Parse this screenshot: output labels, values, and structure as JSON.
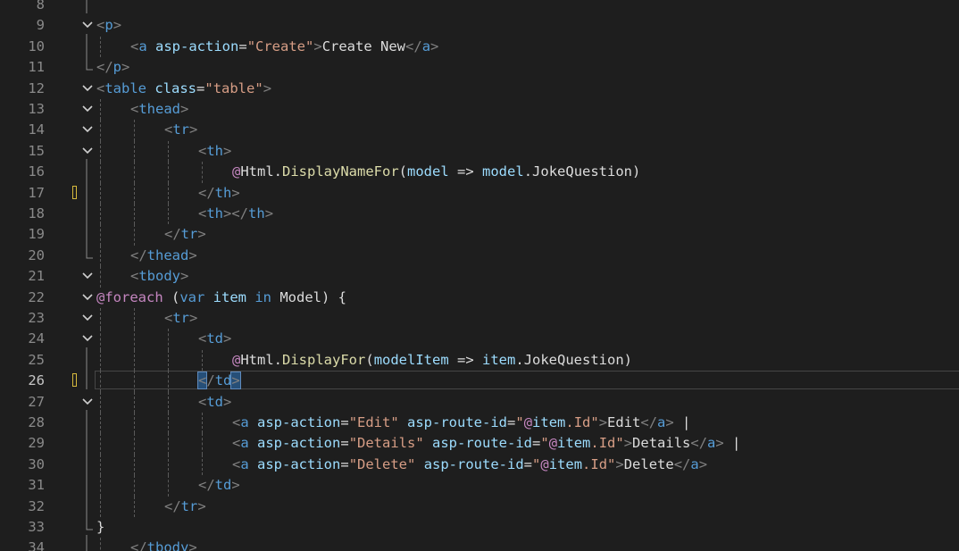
{
  "editor": {
    "active_line": 26,
    "lines": [
      {
        "num": "8",
        "fold": "",
        "indent": 0,
        "tokens": []
      },
      {
        "num": "9",
        "fold": "open",
        "indent": 0,
        "tokens": [
          [
            "t-delim",
            "<"
          ],
          [
            "t-tag",
            "p"
          ],
          [
            "t-delim",
            ">"
          ]
        ]
      },
      {
        "num": "10",
        "fold": "",
        "indent": 1,
        "tokens": [
          [
            "t-delim",
            "<"
          ],
          [
            "t-tag",
            "a "
          ],
          [
            "t-attr",
            "asp-action"
          ],
          [
            "t-text",
            "="
          ],
          [
            "t-str",
            "\"Create\""
          ],
          [
            "t-delim",
            ">"
          ],
          [
            "t-text",
            "Create New"
          ],
          [
            "t-delim",
            "</"
          ],
          [
            "t-tag",
            "a"
          ],
          [
            "t-delim",
            ">"
          ]
        ]
      },
      {
        "num": "11",
        "fold": "end",
        "indent": 0,
        "tokens": [
          [
            "t-delim",
            "</"
          ],
          [
            "t-tag",
            "p"
          ],
          [
            "t-delim",
            ">"
          ]
        ]
      },
      {
        "num": "12",
        "fold": "open",
        "indent": 0,
        "tokens": [
          [
            "t-delim",
            "<"
          ],
          [
            "t-tag",
            "table "
          ],
          [
            "t-attr",
            "class"
          ],
          [
            "t-text",
            "="
          ],
          [
            "t-str",
            "\"table\""
          ],
          [
            "t-delim",
            ">"
          ]
        ]
      },
      {
        "num": "13",
        "fold": "open",
        "indent": 1,
        "tokens": [
          [
            "t-delim",
            "<"
          ],
          [
            "t-tag",
            "thead"
          ],
          [
            "t-delim",
            ">"
          ]
        ]
      },
      {
        "num": "14",
        "fold": "open",
        "indent": 2,
        "tokens": [
          [
            "t-delim",
            "<"
          ],
          [
            "t-tag",
            "tr"
          ],
          [
            "t-delim",
            ">"
          ]
        ]
      },
      {
        "num": "15",
        "fold": "open",
        "indent": 3,
        "tokens": [
          [
            "t-delim",
            "<"
          ],
          [
            "t-tag",
            "th"
          ],
          [
            "t-delim",
            ">"
          ]
        ]
      },
      {
        "num": "16",
        "fold": "",
        "indent": 4,
        "tokens": [
          [
            "t-razor",
            "@"
          ],
          [
            "t-text",
            "Html"
          ],
          [
            "t-text",
            "."
          ],
          [
            "t-method",
            "DisplayNameFor"
          ],
          [
            "t-text",
            "("
          ],
          [
            "t-param",
            "model"
          ],
          [
            "t-text",
            " => "
          ],
          [
            "t-param",
            "model"
          ],
          [
            "t-text",
            "."
          ],
          [
            "t-text",
            "JokeQuestion)"
          ]
        ]
      },
      {
        "num": "17",
        "fold": "",
        "indent": 3,
        "marker": true,
        "tokens": [
          [
            "t-delim",
            "</"
          ],
          [
            "t-tag",
            "th"
          ],
          [
            "t-delim",
            ">"
          ]
        ]
      },
      {
        "num": "18",
        "fold": "",
        "indent": 3,
        "tokens": [
          [
            "t-delim",
            "<"
          ],
          [
            "t-tag",
            "th"
          ],
          [
            "t-delim",
            "></"
          ],
          [
            "t-tag",
            "th"
          ],
          [
            "t-delim",
            ">"
          ]
        ]
      },
      {
        "num": "19",
        "fold": "",
        "indent": 2,
        "tokens": [
          [
            "t-delim",
            "</"
          ],
          [
            "t-tag",
            "tr"
          ],
          [
            "t-delim",
            ">"
          ]
        ]
      },
      {
        "num": "20",
        "fold": "end",
        "indent": 1,
        "tokens": [
          [
            "t-delim",
            "</"
          ],
          [
            "t-tag",
            "thead"
          ],
          [
            "t-delim",
            ">"
          ]
        ]
      },
      {
        "num": "21",
        "fold": "open",
        "indent": 1,
        "tokens": [
          [
            "t-delim",
            "<"
          ],
          [
            "t-tag",
            "tbody"
          ],
          [
            "t-delim",
            ">"
          ]
        ]
      },
      {
        "num": "22",
        "fold": "open",
        "indent": 0,
        "tokens": [
          [
            "t-razor",
            "@foreach"
          ],
          [
            "t-text",
            " ("
          ],
          [
            "t-kw",
            "var"
          ],
          [
            "t-text",
            " "
          ],
          [
            "t-param",
            "item"
          ],
          [
            "t-text",
            " "
          ],
          [
            "t-kw",
            "in"
          ],
          [
            "t-text",
            " Model) {"
          ]
        ]
      },
      {
        "num": "23",
        "fold": "open",
        "indent": 2,
        "tokens": [
          [
            "t-delim",
            "<"
          ],
          [
            "t-tag",
            "tr"
          ],
          [
            "t-delim",
            ">"
          ]
        ]
      },
      {
        "num": "24",
        "fold": "open",
        "indent": 3,
        "tokens": [
          [
            "t-delim",
            "<"
          ],
          [
            "t-tag",
            "td"
          ],
          [
            "t-delim",
            ">"
          ]
        ]
      },
      {
        "num": "25",
        "fold": "",
        "indent": 4,
        "tokens": [
          [
            "t-razor",
            "@"
          ],
          [
            "t-text",
            "Html"
          ],
          [
            "t-text",
            "."
          ],
          [
            "t-method",
            "DisplayFor"
          ],
          [
            "t-text",
            "("
          ],
          [
            "t-param",
            "modelItem"
          ],
          [
            "t-text",
            " => "
          ],
          [
            "t-param",
            "item"
          ],
          [
            "t-text",
            "."
          ],
          [
            "t-text",
            "JokeQuestion)"
          ]
        ]
      },
      {
        "num": "26",
        "fold": "",
        "indent": 3,
        "marker": true,
        "current": true,
        "tokens": [
          [
            "t-delim hl",
            "<"
          ],
          [
            "t-delim",
            "/"
          ],
          [
            "t-tag",
            "td"
          ],
          [
            "t-delim hl",
            ">"
          ]
        ]
      },
      {
        "num": "27",
        "fold": "open",
        "indent": 3,
        "tokens": [
          [
            "t-delim",
            "<"
          ],
          [
            "t-tag",
            "td"
          ],
          [
            "t-delim",
            ">"
          ]
        ]
      },
      {
        "num": "28",
        "fold": "",
        "indent": 4,
        "tokens": [
          [
            "t-delim",
            "<"
          ],
          [
            "t-tag",
            "a "
          ],
          [
            "t-attr",
            "asp-action"
          ],
          [
            "t-text",
            "="
          ],
          [
            "t-str",
            "\"Edit\" "
          ],
          [
            "t-attr",
            "asp-route-id"
          ],
          [
            "t-text",
            "="
          ],
          [
            "t-str",
            "\""
          ],
          [
            "t-razor",
            "@"
          ],
          [
            "t-param",
            "item"
          ],
          [
            "t-str",
            ".Id\""
          ],
          [
            "t-delim",
            ">"
          ],
          [
            "t-text",
            "Edit"
          ],
          [
            "t-delim",
            "</"
          ],
          [
            "t-tag",
            "a"
          ],
          [
            "t-delim",
            ">"
          ],
          [
            "t-text",
            " |"
          ]
        ]
      },
      {
        "num": "29",
        "fold": "",
        "indent": 4,
        "tokens": [
          [
            "t-delim",
            "<"
          ],
          [
            "t-tag",
            "a "
          ],
          [
            "t-attr",
            "asp-action"
          ],
          [
            "t-text",
            "="
          ],
          [
            "t-str",
            "\"Details\" "
          ],
          [
            "t-attr",
            "asp-route-id"
          ],
          [
            "t-text",
            "="
          ],
          [
            "t-str",
            "\""
          ],
          [
            "t-razor",
            "@"
          ],
          [
            "t-param",
            "item"
          ],
          [
            "t-str",
            ".Id\""
          ],
          [
            "t-delim",
            ">"
          ],
          [
            "t-text",
            "Details"
          ],
          [
            "t-delim",
            "</"
          ],
          [
            "t-tag",
            "a"
          ],
          [
            "t-delim",
            ">"
          ],
          [
            "t-text",
            " |"
          ]
        ]
      },
      {
        "num": "30",
        "fold": "",
        "indent": 4,
        "tokens": [
          [
            "t-delim",
            "<"
          ],
          [
            "t-tag",
            "a "
          ],
          [
            "t-attr",
            "asp-action"
          ],
          [
            "t-text",
            "="
          ],
          [
            "t-str",
            "\"Delete\" "
          ],
          [
            "t-attr",
            "asp-route-id"
          ],
          [
            "t-text",
            "="
          ],
          [
            "t-str",
            "\""
          ],
          [
            "t-razor",
            "@"
          ],
          [
            "t-param",
            "item"
          ],
          [
            "t-str",
            ".Id\""
          ],
          [
            "t-delim",
            ">"
          ],
          [
            "t-text",
            "Delete"
          ],
          [
            "t-delim",
            "</"
          ],
          [
            "t-tag",
            "a"
          ],
          [
            "t-delim",
            ">"
          ]
        ]
      },
      {
        "num": "31",
        "fold": "",
        "indent": 3,
        "tokens": [
          [
            "t-delim",
            "</"
          ],
          [
            "t-tag",
            "td"
          ],
          [
            "t-delim",
            ">"
          ]
        ]
      },
      {
        "num": "32",
        "fold": "",
        "indent": 2,
        "tokens": [
          [
            "t-delim",
            "</"
          ],
          [
            "t-tag",
            "tr"
          ],
          [
            "t-delim",
            ">"
          ]
        ]
      },
      {
        "num": "33",
        "fold": "end",
        "indent": 0,
        "tokens": [
          [
            "t-text",
            "}"
          ]
        ]
      },
      {
        "num": "34",
        "fold": "",
        "indent": 1,
        "tokens": [
          [
            "t-delim",
            "</"
          ],
          [
            "t-tag",
            "tbody"
          ],
          [
            "t-delim",
            ">"
          ]
        ]
      }
    ]
  }
}
